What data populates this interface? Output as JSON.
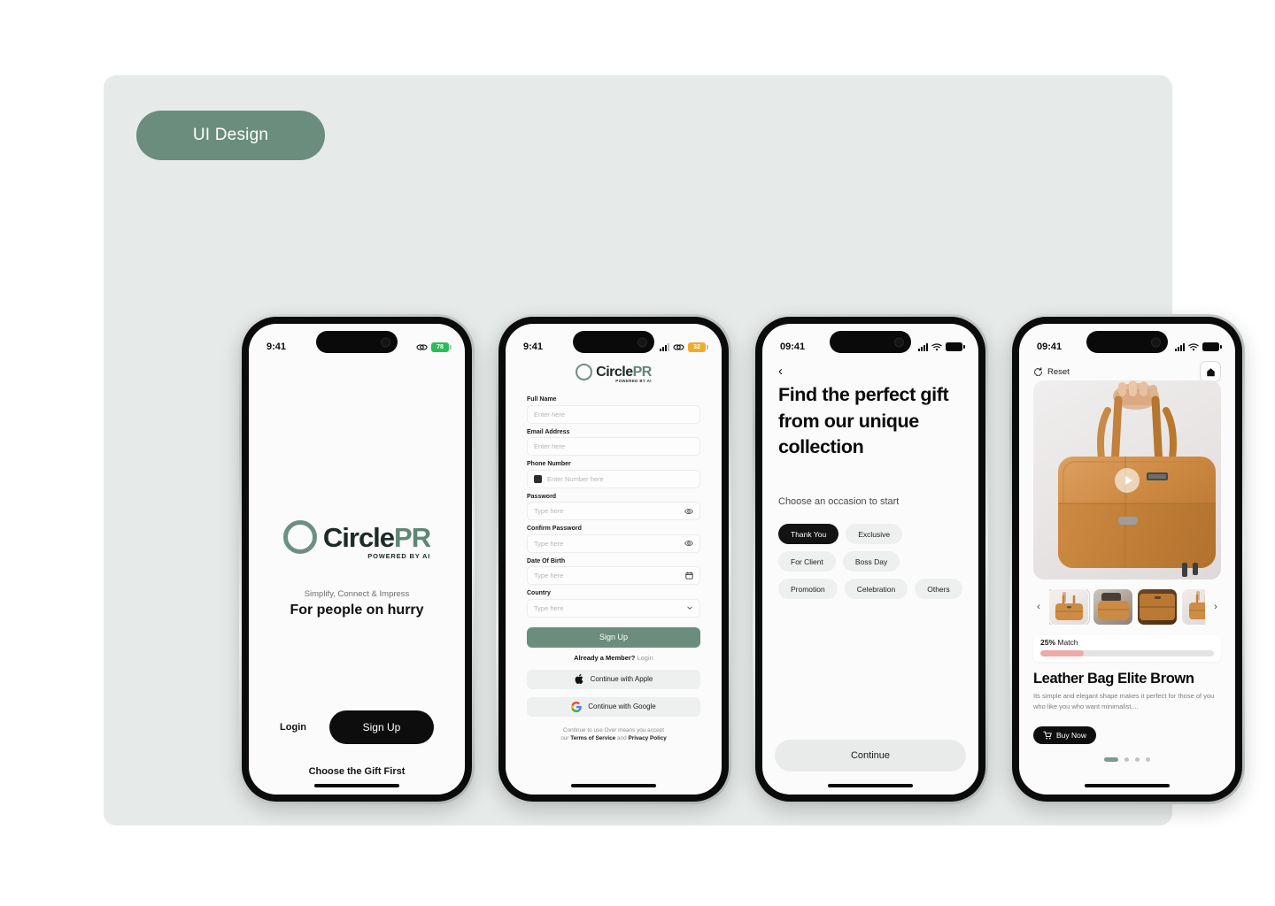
{
  "badge": {
    "label": "UI Design"
  },
  "brand": {
    "name_dark": "Circle",
    "name_accent": "PR",
    "sub": "POWERED BY AI",
    "accent_color": "#6a8d7d",
    "dark_color": "#1d2b26"
  },
  "screen1": {
    "status": {
      "time": "9:41",
      "battery": "78"
    },
    "tagline": "Simplify, Connect & Impress",
    "headline": "For people on hurry",
    "login_label": "Login",
    "signup_label": "Sign Up",
    "footer_label": "Choose the Gift First"
  },
  "screen2": {
    "status": {
      "time": "9:41",
      "battery": "32"
    },
    "fields": [
      {
        "label": "Full Name",
        "placeholder": "Enter here",
        "value": "",
        "kind": "text"
      },
      {
        "label": "Email Address",
        "placeholder": "Enter here",
        "value": "",
        "kind": "text"
      },
      {
        "label": "Phone Number",
        "placeholder": "Enter Number here",
        "value": "",
        "kind": "phone"
      },
      {
        "label": "Password",
        "placeholder": "Type here",
        "value": "",
        "kind": "password"
      },
      {
        "label": "Confirm Password",
        "placeholder": "Type here",
        "value": "",
        "kind": "password"
      },
      {
        "label": "Date Of Birth",
        "placeholder": "Type here",
        "value": "",
        "kind": "date"
      },
      {
        "label": "Country",
        "placeholder": "Type here",
        "value": "",
        "kind": "select"
      }
    ],
    "signup_label": "Sign Up",
    "member_text": "Already a Member? ",
    "member_link": "Login",
    "apple_label": "Continue with Apple",
    "google_label": "Continue with Google",
    "terms_line1": "Continue to use Over means you accept",
    "terms_pre": "our ",
    "terms_service": "Terms of Service",
    "terms_and": " and ",
    "terms_privacy": "Privacy Policy"
  },
  "screen3": {
    "status": {
      "time": "09:41"
    },
    "headline": "Find the perfect gift from our unique collection",
    "subtitle": "Choose an occasion to start",
    "chips": [
      {
        "label": "Thank You",
        "selected": true
      },
      {
        "label": "Exclusive",
        "selected": false
      },
      {
        "label": "For Client",
        "selected": false
      },
      {
        "label": "Boss Day",
        "selected": false
      },
      {
        "label": "Promotion",
        "selected": false
      },
      {
        "label": "Celebration",
        "selected": false
      },
      {
        "label": "Others",
        "selected": false
      }
    ],
    "continue_label": "Continue"
  },
  "screen4": {
    "status": {
      "time": "09:41"
    },
    "reset_label": "Reset",
    "match_percent": "25%",
    "match_label": "Match",
    "match_value": 25,
    "match_color": "#edaaa8",
    "product_title": "Leather Bag Elite Brown",
    "product_desc": "Its simple and elegant shape makes it perfect for those of you who like you who want minimalist....",
    "buy_label": "Buy Now",
    "thumbs": [
      {
        "selected": true
      },
      {
        "selected": false
      },
      {
        "selected": false
      },
      {
        "selected": false
      }
    ],
    "dots": [
      true,
      false,
      false,
      false
    ]
  }
}
